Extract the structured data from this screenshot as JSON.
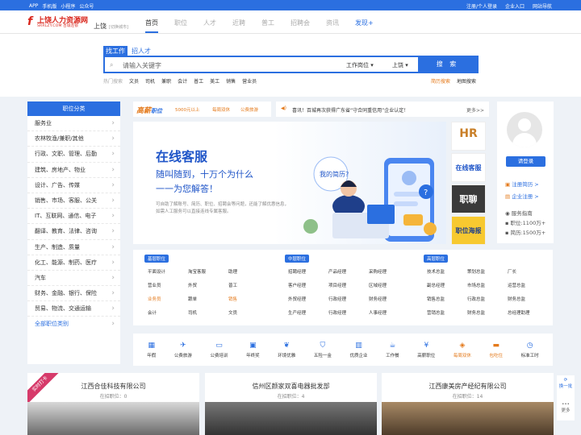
{
  "topbar": {
    "links": [
      "APP",
      "手机版",
      "小程序",
      "公众号"
    ],
    "right": [
      "注册/个人登录",
      "企业入口",
      "网站导航"
    ]
  },
  "header": {
    "logo_title": "上饶人力资源网",
    "logo_sub": "SRRLZY.COM 百城连锁",
    "city": "上饶",
    "city_switch": "[切换城市]",
    "nav": [
      "首页",
      "职位",
      "人才",
      "近聘",
      "普工",
      "招聘会",
      "资讯",
      "发现+"
    ]
  },
  "search": {
    "tab_job": "找工作",
    "tab_talent": "招人才",
    "placeholder": "请输入关键字",
    "dd_type": "工作岗位",
    "dd_city": "上饶",
    "button": "搜 索",
    "hot_label": "热门搜索",
    "hot": [
      "文员",
      "司机",
      "兼职",
      "会计",
      "普工",
      "美工",
      "销售",
      "营业员"
    ],
    "links": [
      "简历搜索",
      "地图搜索"
    ]
  },
  "categories": {
    "title": "职位分类",
    "items": [
      "服务业",
      "农林牧渔/兼职/其他",
      "行政、文职、管理、后勤",
      "建筑、房地产、物业",
      "设计、广告、传媒",
      "销售、市场、客服、公关",
      "IT、互联网、通信、电子",
      "翻译、教育、法律、咨询",
      "生产、制造、质量",
      "化工、能源、制药、医疗",
      "汽车",
      "财务、金融、银行、保险",
      "贸易、物流、交通运输"
    ],
    "all": "全部职位类别"
  },
  "adbar": {
    "brand": "高薪",
    "brand2": "职位",
    "t1": "5000元以上",
    "t2": "每周双休",
    "t3": "公费旅游"
  },
  "notice": {
    "text": "喜讯！百城再次获得广东省“守合同重信用”企业认定！",
    "more": "更多>>"
  },
  "banner": {
    "title": "在线客服",
    "line1": "随叫随到，十万个为什么",
    "line2": "一一为您解答！",
    "desc": "可自助了解账号、简历、职位、招聘会等问题，还能了解优惠信息，如需人工服务可以直接连线专属客服。",
    "bubble": "我的简历?"
  },
  "side_ads": [
    "HR",
    "在线客服",
    "职聊",
    "职位海报"
  ],
  "user": {
    "login": "请登录",
    "reg_resume": "注册简历 >",
    "company_login": "企业注册 >",
    "guide": "服务指南",
    "job_price": "职位:1100万+",
    "resume_price": "简历:1500万+"
  },
  "jobs": {
    "cols": [
      {
        "tag": "基层职位",
        "items": [
          "平面设计",
          "淘宝客服",
          "助理",
          "营业员",
          "外贸",
          "普工",
          "业务员",
          "跟单",
          "销售",
          "会计",
          "司机",
          "文员"
        ]
      },
      {
        "tag": "中层职位",
        "items": [
          "招聘经理",
          "产品经理",
          "采购经理",
          "客户经理",
          "项目经理",
          "区域经理",
          "外贸经理",
          "行政经理",
          "财务经理",
          "生产经理",
          "行政经理",
          "人事经理"
        ]
      },
      {
        "tag": "高层职位",
        "items": [
          "技术总监",
          "策划总监",
          "厂长",
          "副总经理",
          "市场总监",
          "运营总监",
          "销售总监",
          "行政总监",
          "财务总监",
          "营销总监",
          "财务总监",
          "总经理助理"
        ]
      }
    ]
  },
  "icons": [
    {
      "name": "年假",
      "icon": "calendar"
    },
    {
      "name": "公费旅游",
      "icon": "plane"
    },
    {
      "name": "公费培训",
      "icon": "screen"
    },
    {
      "name": "年终奖",
      "icon": "gift"
    },
    {
      "name": "环境优雅",
      "icon": "leaf"
    },
    {
      "name": "五险一金",
      "icon": "shield"
    },
    {
      "name": "优质企业",
      "icon": "building"
    },
    {
      "name": "工作餐",
      "icon": "cup"
    },
    {
      "name": "高薪职位",
      "icon": "money"
    },
    {
      "name": "每周双休",
      "icon": "tag"
    },
    {
      "name": "包吃住",
      "icon": "bed"
    },
    {
      "name": "标准工时",
      "icon": "clock"
    }
  ],
  "companies": [
    {
      "name": "江西合佳科技有限公司",
      "count": "在招职位：0",
      "ribbon": "实时打卡"
    },
    {
      "name": "信州区颜家双喜电器批发部",
      "count": "在招职位：4"
    },
    {
      "name": "江西康美房产经纪有限公司",
      "count": "在招职位：14"
    }
  ],
  "float": {
    "a": "换一批",
    "b": "更多"
  }
}
